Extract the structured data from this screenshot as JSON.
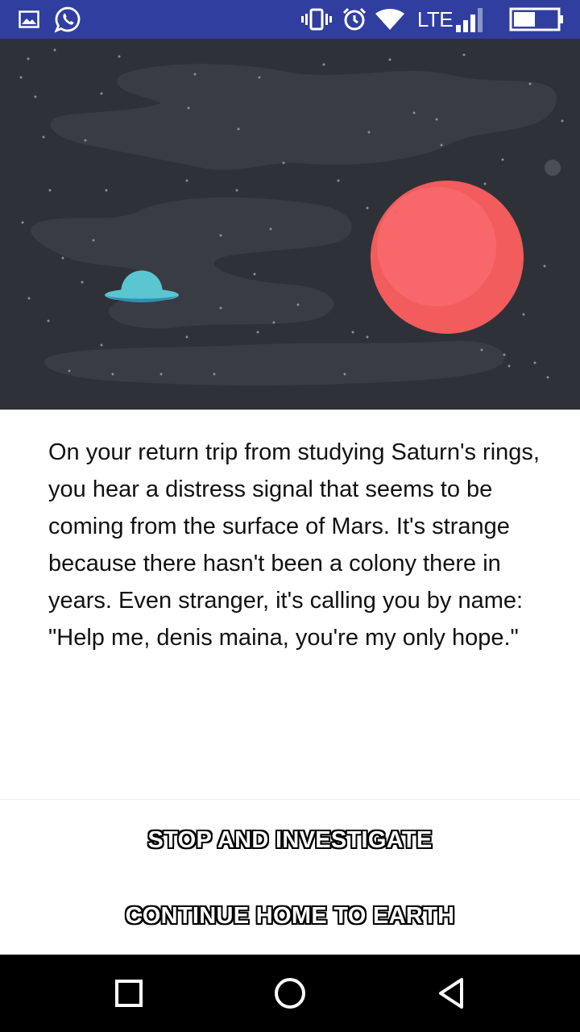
{
  "status_bar": {
    "network_label": "LTE",
    "icons": [
      "gallery-icon",
      "whatsapp-icon",
      "vibrate-icon",
      "alarm-icon",
      "wifi-icon",
      "signal-icon",
      "battery-icon"
    ]
  },
  "scene": {
    "icons": [
      "ufo-icon",
      "mars-planet-icon"
    ],
    "colors": {
      "background": "#2f3138",
      "planet": "#f25c5c",
      "ufo": "#5bc5d1"
    }
  },
  "story": {
    "text": "On your return trip from studying Saturn's rings, you hear a distress signal that seems to be coming from the surface of Mars. It's strange because there hasn't been a colony there in years. Even stranger, it's calling you by name: \"Help me, denis maina, you're my only hope.\""
  },
  "choices": {
    "choice1_label": "STOP AND INVESTIGATE",
    "choice2_label": "CONTINUE HOME TO EARTH"
  },
  "nav_bar": {
    "icons": [
      "recents-icon",
      "home-icon",
      "back-icon"
    ]
  },
  "colors": {
    "status_bar": "#303f9f",
    "nav_bar": "#000000",
    "text": "#111111"
  }
}
